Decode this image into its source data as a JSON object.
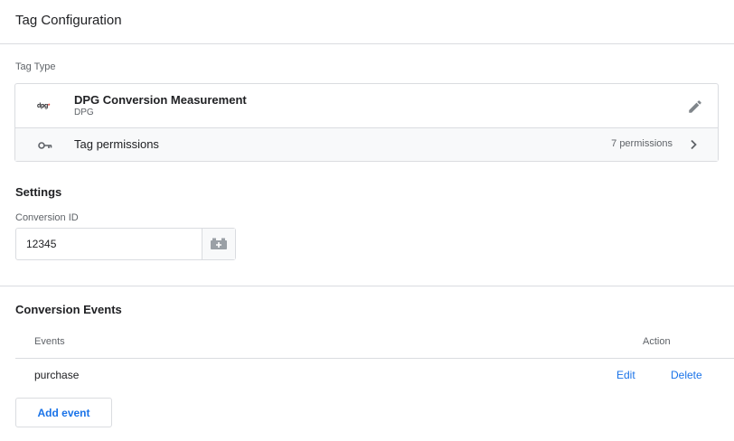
{
  "header": {
    "title": "Tag Configuration"
  },
  "tag_type": {
    "section_label": "Tag Type",
    "logo_text": "dpg",
    "name": "DPG Conversion Measurement",
    "vendor": "DPG",
    "permissions_label": "Tag permissions",
    "permissions_count": "7 permissions",
    "icons": {
      "edit": "pencil-icon",
      "permissions": "key-icon",
      "expand": "chevron-right-icon"
    }
  },
  "settings": {
    "title": "Settings",
    "conversion_id_label": "Conversion ID",
    "conversion_id_value": "12345",
    "variable_icon": "variable-picker-icon"
  },
  "conversion_events": {
    "title": "Conversion Events",
    "columns": {
      "events": "Events",
      "action": "Action"
    },
    "rows": [
      {
        "event": "purchase",
        "edit_label": "Edit",
        "delete_label": "Delete"
      }
    ],
    "add_button_label": "Add event"
  },
  "colors": {
    "link": "#1a73e8",
    "border": "#dadce0",
    "text": "#202124",
    "muted": "#5f6368",
    "logo_accent": "#d93025"
  }
}
